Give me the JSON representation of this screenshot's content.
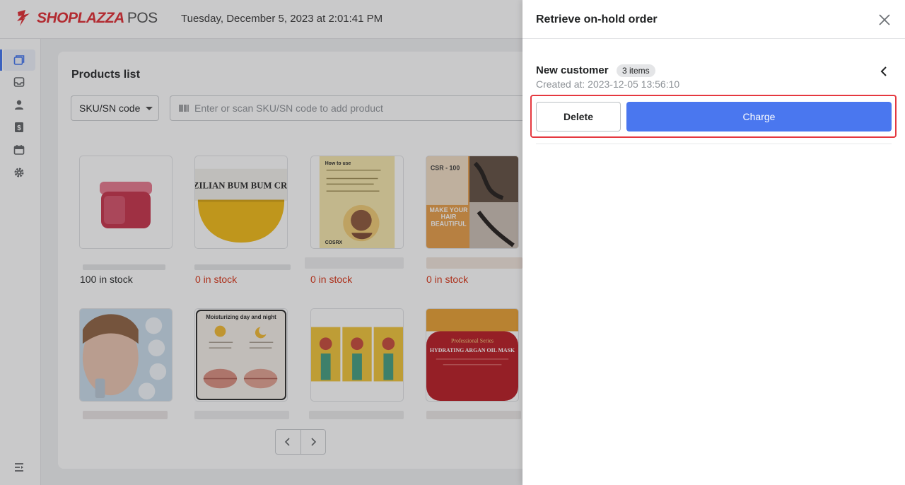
{
  "header": {
    "brand": "SHOPLAZZA",
    "brand_suffix": "POS",
    "datetime": "Tuesday, December 5, 2023 at 2:01:41 PM"
  },
  "sidebar": {
    "items": [
      {
        "name": "orders",
        "icon": "register-icon",
        "active": true
      },
      {
        "name": "inbox",
        "icon": "inbox-icon",
        "active": false
      },
      {
        "name": "customers",
        "icon": "person-icon",
        "active": false
      },
      {
        "name": "payments",
        "icon": "dollar-icon",
        "active": false
      },
      {
        "name": "store",
        "icon": "calendar-icon",
        "active": false
      },
      {
        "name": "settings",
        "icon": "gear-icon",
        "active": false
      }
    ],
    "bottom_icon": "collapse-menu-icon"
  },
  "products": {
    "title": "Products list",
    "search_mode": "SKU/SN code",
    "search_placeholder": "Enter or scan SKU/SN code to add product",
    "items": [
      {
        "stock": "100 in stock",
        "in_stock": true
      },
      {
        "stock": "0 in stock",
        "in_stock": false
      },
      {
        "stock": "0 in stock",
        "in_stock": false
      },
      {
        "stock": "0 in stock",
        "in_stock": false
      },
      {
        "stock": "",
        "in_stock": null
      },
      {
        "stock": "",
        "in_stock": null
      },
      {
        "stock": "",
        "in_stock": null
      },
      {
        "stock": "",
        "in_stock": null
      }
    ],
    "image_texts": {
      "cream": "BRAZILIAN BUM BUM CREAM",
      "howto": "How to use",
      "cosrx": "COSRX",
      "hair_tag": "CSR - 100",
      "hair": "MAKE YOUR HAIR BEAUTIFUL",
      "moist": "Moisturizing day and night",
      "mask_series": "Professional Series",
      "mask_name": "HYDRATING ARGAN OIL MASK"
    }
  },
  "drawer": {
    "title": "Retrieve on-hold order",
    "customer": "New customer",
    "items_count": "3 items",
    "created_at": "Created at: 2023-12-05 13:56:10",
    "delete_label": "Delete",
    "charge_label": "Charge"
  },
  "colors": {
    "brand": "#e0252b",
    "primary": "#4a77ef",
    "highlight": "#e5383f",
    "out_of_stock": "#d72c0d"
  }
}
